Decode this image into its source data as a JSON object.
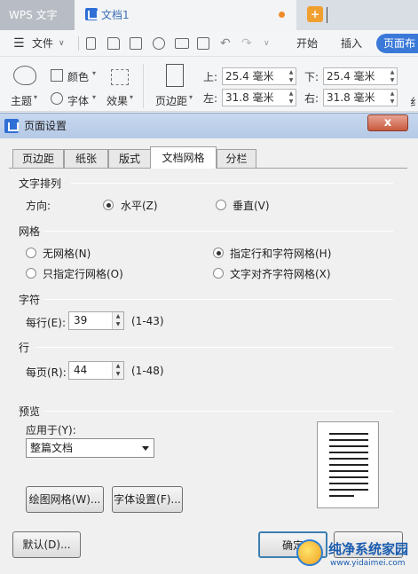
{
  "app": {
    "app_tab": "WPS 文字",
    "doc_tab": "文档1",
    "new_tab": "+"
  },
  "menubar": {
    "menu_icon": "☰",
    "file_label": "文件",
    "ribbon_tabs": [
      "开始",
      "插入",
      "页面布"
    ]
  },
  "ribbon": {
    "theme": "主题",
    "color": "颜色",
    "font": "字体",
    "effect": "效果",
    "margins": "页边距",
    "top_label": "上:",
    "top_value": "25.4 毫米",
    "bottom_label": "下:",
    "bottom_value": "25.4 毫米",
    "left_label": "左:",
    "left_value": "31.8 毫米",
    "right_label": "右:",
    "right_value": "31.8 毫米",
    "edge_char": "纟"
  },
  "dialog": {
    "title": "页面设置",
    "close": "x",
    "tabs": [
      "页边距",
      "纸张",
      "版式",
      "文档网格",
      "分栏"
    ],
    "active_tab": 3,
    "text_direction": {
      "title": "文字排列",
      "direction_label": "方向:",
      "horizontal": "水平(Z)",
      "vertical": "垂直(V)",
      "selected": "horizontal"
    },
    "grid": {
      "title": "网格",
      "options": [
        "无网格(N)",
        "指定行和字符网格(H)",
        "只指定行网格(O)",
        "文字对齐字符网格(X)"
      ],
      "selected": 1
    },
    "chars": {
      "title": "字符",
      "per_line_label": "每行(E):",
      "per_line_value": "39",
      "range": "(1-43)"
    },
    "lines": {
      "title": "行",
      "per_page_label": "每页(R):",
      "per_page_value": "44",
      "range": "(1-48)"
    },
    "preview": {
      "title": "预览",
      "apply_label": "应用于(Y):",
      "apply_value": "整篇文档"
    },
    "buttons": {
      "draw_grid": "绘图网格(W)...",
      "font_settings": "字体设置(F)...",
      "default": "默认(D)...",
      "ok": "确定",
      "cancel": ""
    }
  },
  "watermark": {
    "title": "纯净系统家园",
    "url": "www.yidaimei.com"
  }
}
